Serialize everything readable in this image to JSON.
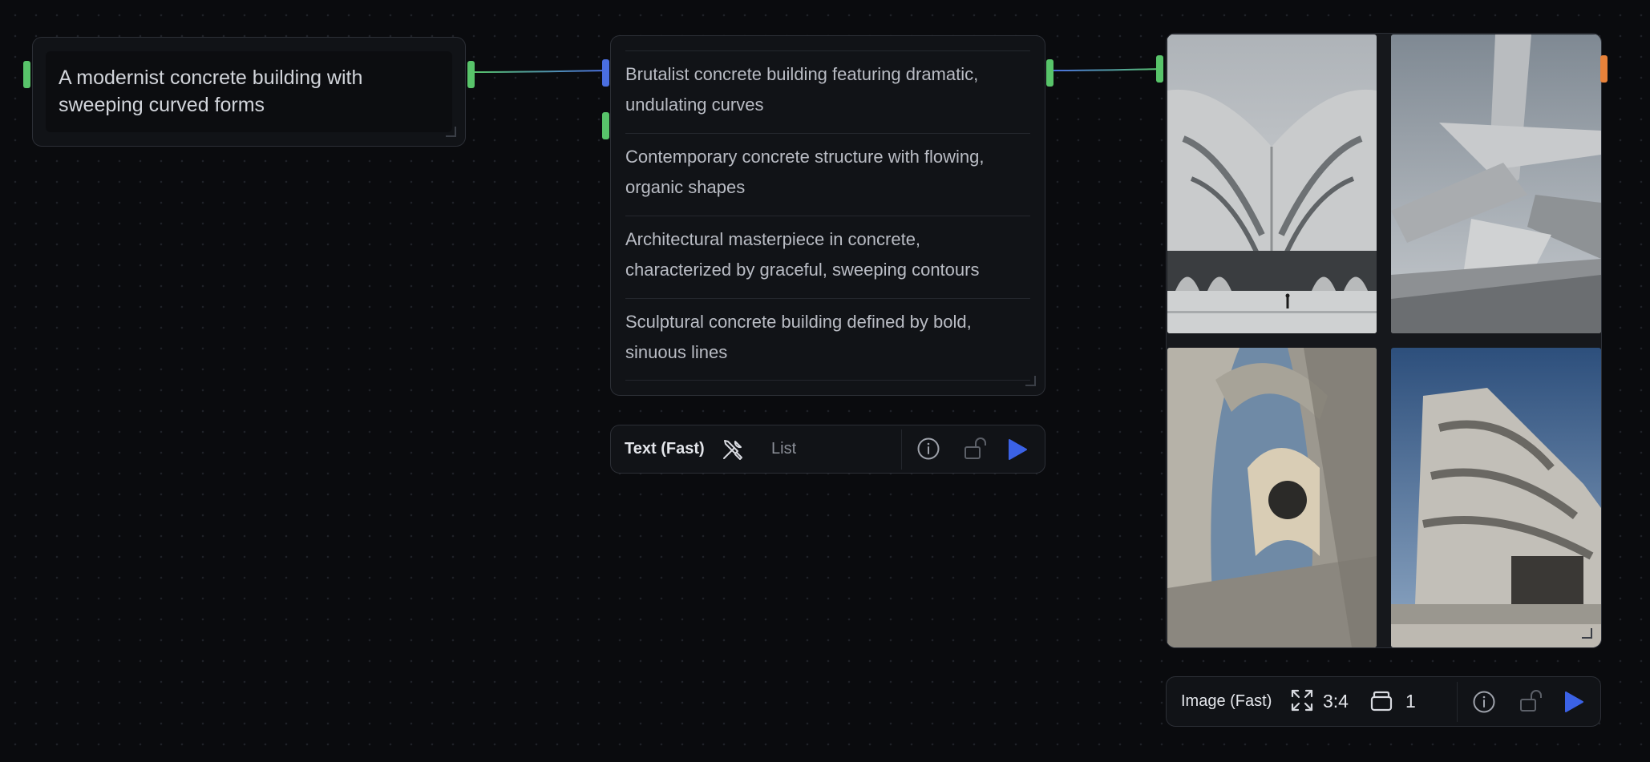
{
  "prompt_node": {
    "text": "A modernist concrete building with sweeping curved forms"
  },
  "list_node": {
    "items": [
      "Brutalist concrete building featuring dramatic, undulating curves",
      "Contemporary concrete structure with flowing, organic shapes",
      "Architectural masterpiece in concrete, characterized by graceful, sweeping contours",
      "Sculptural concrete building defined by bold, sinuous lines"
    ]
  },
  "text_toolbar": {
    "model_label": "Text (Fast)",
    "tools_icon": "tools-icon",
    "mode_label": "List",
    "info_icon": "info-icon",
    "lock_icon": "unlock-icon",
    "run_icon": "play-icon"
  },
  "image_node": {
    "images": [
      {
        "description_icon": "building-image-1"
      },
      {
        "description_icon": "building-image-2"
      },
      {
        "description_icon": "building-image-3"
      },
      {
        "description_icon": "building-image-4"
      }
    ]
  },
  "image_toolbar": {
    "model_label": "Image (Fast)",
    "aspect_ratio": "3:4",
    "count": "1",
    "expand_icon": "expand-icon",
    "stack_icon": "stack-icon",
    "info_icon": "info-icon",
    "lock_icon": "unlock-icon",
    "run_icon": "play-icon"
  },
  "colors": {
    "background": "#0a0b0e",
    "handle_green": "#58c46a",
    "handle_blue": "#4a6ee0",
    "handle_orange": "#e8823a",
    "play_blue": "#3b62e6"
  }
}
